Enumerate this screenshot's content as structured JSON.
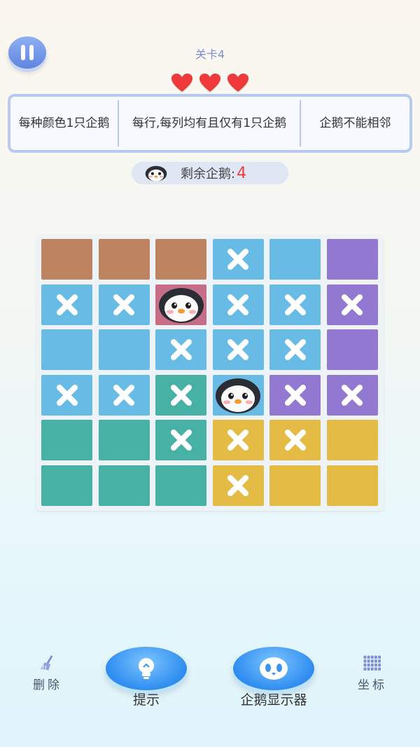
{
  "header": {
    "level_title": "关卡4",
    "lives": 3,
    "colors": {
      "heart": "#ee3a3a",
      "accent": "#7d8fd0"
    }
  },
  "rules": [
    "每种颜色1只企鹅",
    "每行,每列均有且仅有1只企鹅",
    "企鹅不能相邻"
  ],
  "remaining": {
    "label": "剩余企鹅:",
    "value": "4"
  },
  "board": {
    "rows": 6,
    "cols": 6,
    "palette": {
      "brown": "#be8462",
      "blue": "#68bbe5",
      "purple": "#9278d0",
      "pink": "#c86d88",
      "teal": "#47b1a6",
      "yellow": "#e3bb45"
    },
    "cells": [
      [
        {
          "color": "brown",
          "mark": ""
        },
        {
          "color": "brown",
          "mark": ""
        },
        {
          "color": "brown",
          "mark": ""
        },
        {
          "color": "blue",
          "mark": "x"
        },
        {
          "color": "blue",
          "mark": ""
        },
        {
          "color": "purple",
          "mark": ""
        }
      ],
      [
        {
          "color": "blue",
          "mark": "x"
        },
        {
          "color": "blue",
          "mark": "x"
        },
        {
          "color": "pink",
          "mark": "penguin"
        },
        {
          "color": "blue",
          "mark": "x"
        },
        {
          "color": "blue",
          "mark": "x"
        },
        {
          "color": "purple",
          "mark": "x"
        }
      ],
      [
        {
          "color": "blue",
          "mark": ""
        },
        {
          "color": "blue",
          "mark": ""
        },
        {
          "color": "blue",
          "mark": "x"
        },
        {
          "color": "blue",
          "mark": "x"
        },
        {
          "color": "blue",
          "mark": "x"
        },
        {
          "color": "purple",
          "mark": ""
        }
      ],
      [
        {
          "color": "blue",
          "mark": "x"
        },
        {
          "color": "blue",
          "mark": "x"
        },
        {
          "color": "teal",
          "mark": "x"
        },
        {
          "color": "blue",
          "mark": "penguin"
        },
        {
          "color": "purple",
          "mark": "x"
        },
        {
          "color": "purple",
          "mark": "x"
        }
      ],
      [
        {
          "color": "teal",
          "mark": ""
        },
        {
          "color": "teal",
          "mark": ""
        },
        {
          "color": "teal",
          "mark": "x"
        },
        {
          "color": "yellow",
          "mark": "x"
        },
        {
          "color": "yellow",
          "mark": "x"
        },
        {
          "color": "yellow",
          "mark": ""
        }
      ],
      [
        {
          "color": "teal",
          "mark": ""
        },
        {
          "color": "teal",
          "mark": ""
        },
        {
          "color": "teal",
          "mark": ""
        },
        {
          "color": "yellow",
          "mark": "x"
        },
        {
          "color": "yellow",
          "mark": ""
        },
        {
          "color": "yellow",
          "mark": ""
        }
      ]
    ]
  },
  "toolbar": {
    "delete_label": "删除",
    "hint_label": "提示",
    "penguin_display_label": "企鹅显示器",
    "coordinates_label": "坐标",
    "icons": {
      "delete": "broom-icon",
      "hint": "lightbulb-icon",
      "penguin_display": "penguin-icon",
      "coordinates": "grid-icon"
    }
  }
}
